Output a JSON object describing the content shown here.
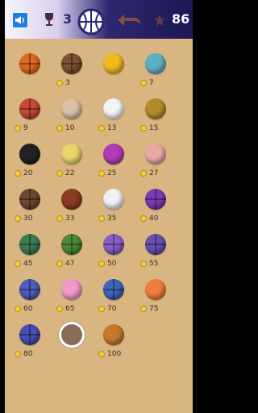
{
  "header": {
    "current_score": "3",
    "coins": "86",
    "icons": [
      "sound-icon",
      "trophy-icon",
      "basketball-icon",
      "back-arrow-icon",
      "star-icon"
    ]
  },
  "balls": [
    {
      "price": "",
      "color": "#e06a1f",
      "style": "lines"
    },
    {
      "price": "3",
      "color": "#7a5036",
      "style": "lines"
    },
    {
      "price": "",
      "color": "#f1b91e",
      "style": "plain"
    },
    {
      "price": "7",
      "color": "#5db1c4",
      "style": "plain"
    },
    {
      "price": "9",
      "color": "#c44a33",
      "style": "lines"
    },
    {
      "price": "10",
      "color": "#d8c1a5",
      "style": "plain"
    },
    {
      "price": "13",
      "color": "#f4f4f4",
      "style": "plain"
    },
    {
      "price": "15",
      "color": "#b38a2b",
      "style": "plain"
    },
    {
      "price": "20",
      "color": "#222222",
      "style": "plain"
    },
    {
      "price": "22",
      "color": "#e8d46a",
      "style": "plain"
    },
    {
      "price": "25",
      "color": "#b13cb6",
      "style": "plain"
    },
    {
      "price": "27",
      "color": "#e9a9a0",
      "style": "plain"
    },
    {
      "price": "30",
      "color": "#6f4630",
      "style": "lines"
    },
    {
      "price": "33",
      "color": "#8b3c23",
      "style": "plain"
    },
    {
      "price": "35",
      "color": "#f0f0f0",
      "style": "plain"
    },
    {
      "price": "40",
      "color": "#7a3bb7",
      "style": "lines"
    },
    {
      "price": "45",
      "color": "#3f7c53",
      "style": "lines"
    },
    {
      "price": "47",
      "color": "#4c8a36",
      "style": "lines"
    },
    {
      "price": "50",
      "color": "#8a5fc8",
      "style": "lines"
    },
    {
      "price": "55",
      "color": "#6451b0",
      "style": "lines"
    },
    {
      "price": "60",
      "color": "#4f5db9",
      "style": "lines"
    },
    {
      "price": "65",
      "color": "#ef9ac9",
      "style": "plain"
    },
    {
      "price": "70",
      "color": "#3d65b8",
      "style": "lines"
    },
    {
      "price": "75",
      "color": "#f07e3a",
      "style": "plain"
    },
    {
      "price": "80",
      "color": "#4a4fb3",
      "style": "lines"
    },
    {
      "price": "",
      "color": "#8a6b57",
      "style": "plain",
      "selected": true
    },
    {
      "price": "100",
      "color": "#c7782d",
      "style": "plain"
    }
  ]
}
